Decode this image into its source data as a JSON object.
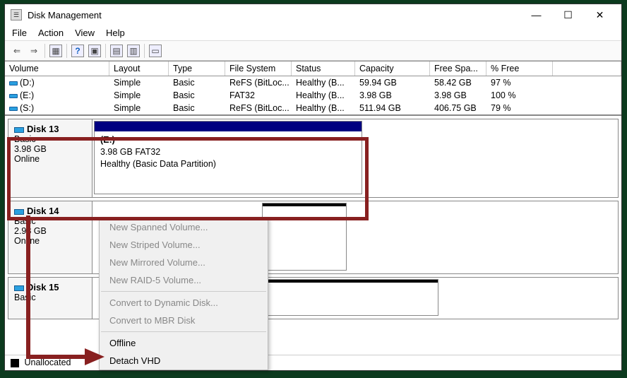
{
  "window": {
    "title": "Disk Management"
  },
  "menu": {
    "file": "File",
    "action": "Action",
    "view": "View",
    "help": "Help"
  },
  "columns": {
    "volume": "Volume",
    "layout": "Layout",
    "type": "Type",
    "fs": "File System",
    "status": "Status",
    "capacity": "Capacity",
    "free": "Free Spa...",
    "pfree": "% Free"
  },
  "volumes": [
    {
      "name": "(D:)",
      "layout": "Simple",
      "type": "Basic",
      "fs": "ReFS (BitLoc...",
      "status": "Healthy (B...",
      "cap": "59.94 GB",
      "free": "58.42 GB",
      "pfree": "97 %"
    },
    {
      "name": "(E:)",
      "layout": "Simple",
      "type": "Basic",
      "fs": "FAT32",
      "status": "Healthy (B...",
      "cap": "3.98 GB",
      "free": "3.98 GB",
      "pfree": "100 %"
    },
    {
      "name": "(S:)",
      "layout": "Simple",
      "type": "Basic",
      "fs": "ReFS (BitLoc...",
      "status": "Healthy (B...",
      "cap": "511.94 GB",
      "free": "406.75 GB",
      "pfree": "79 %"
    }
  ],
  "disks": {
    "d13": {
      "title": "Disk 13",
      "type": "Basic",
      "size": "3.98 GB",
      "state": "Online",
      "part_label": "(E:)",
      "part_line2": "3.98 GB FAT32",
      "part_line3": "Healthy (Basic Data Partition)"
    },
    "d14": {
      "title": "Disk 14",
      "type": "Basic",
      "size": "2.98 GB",
      "state": "Online"
    },
    "d15": {
      "title": "Disk 15",
      "type": "Basic",
      "unalloc": "Unallocated"
    }
  },
  "ctx": {
    "spanned": "New Spanned Volume...",
    "striped": "New Striped Volume...",
    "mirrored": "New Mirrored Volume...",
    "raid5": "New RAID-5 Volume...",
    "dyn": "Convert to Dynamic Disk...",
    "mbr": "Convert to MBR Disk",
    "offline": "Offline",
    "detach": "Detach VHD"
  }
}
